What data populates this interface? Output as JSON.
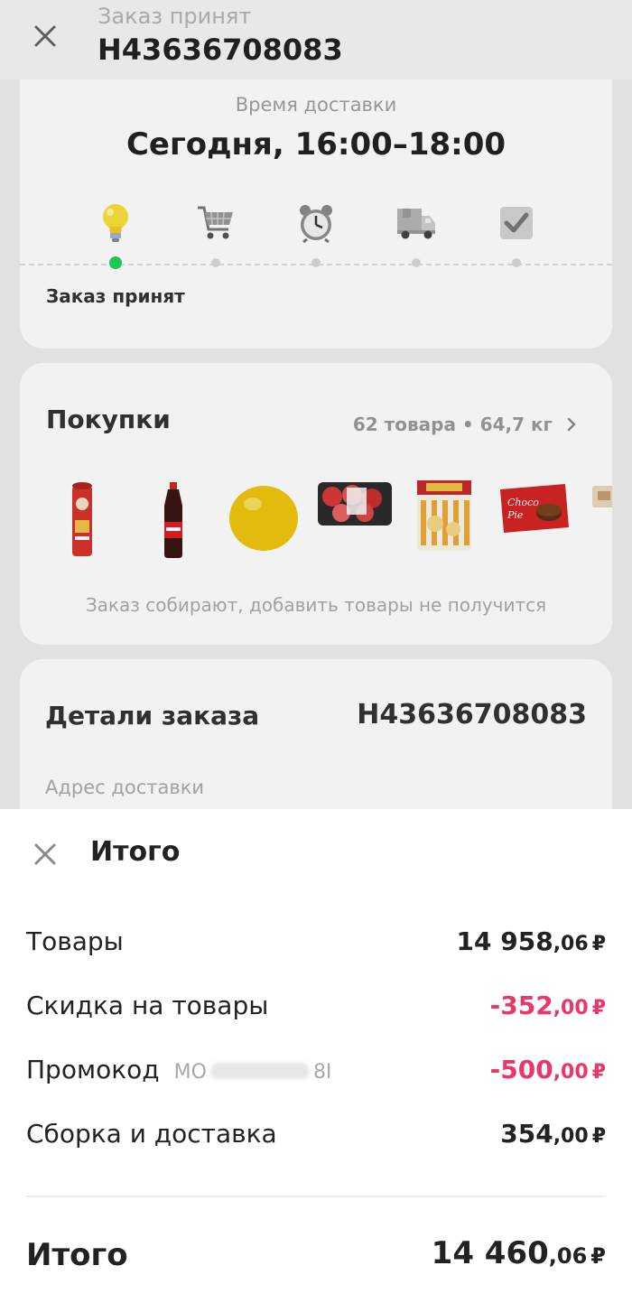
{
  "header": {
    "subtitle": "Заказ принят",
    "order_number": "H43636708083",
    "close_icon": "close-icon"
  },
  "delivery": {
    "label": "Время доставки",
    "time": "Сегодня, 16:00–18:00",
    "steps": [
      {
        "icon": "lightbulb-icon",
        "active": true
      },
      {
        "icon": "shopping-cart-icon",
        "active": false
      },
      {
        "icon": "alarm-clock-icon",
        "active": false
      },
      {
        "icon": "delivery-truck-icon",
        "active": false
      },
      {
        "icon": "checkbox-icon",
        "active": false
      }
    ],
    "status": "Заказ принят",
    "accent_color": "#1fd15c"
  },
  "purchases": {
    "title": "Покупки",
    "meta": "62 товара • 64,7 кг",
    "products": [
      "pringles-can",
      "cola-bottle",
      "yellow-pomelo",
      "apples-tray",
      "snack-bag",
      "choco-pie-box",
      "product-partial"
    ],
    "note": "Заказ собирают, добавить товары не получится"
  },
  "details": {
    "title": "Детали заказа",
    "number": "H43636708083",
    "address_label": "Адрес доставки"
  },
  "summary": {
    "title": "Итого",
    "rows": [
      {
        "label": "Товары",
        "int": "14 958",
        "frac": ",06",
        "currency": "₽"
      },
      {
        "label": "Скидка на товары",
        "int": "-352",
        "frac": ",00",
        "currency": "₽"
      },
      {
        "label": "Промокод",
        "code_start": "MO",
        "code_end": "8I",
        "int": "-500",
        "frac": ",00",
        "currency": "₽"
      },
      {
        "label": "Сборка и доставка",
        "int": "354",
        "frac": ",00",
        "currency": "₽"
      }
    ],
    "total_label": "Итого",
    "total_int": "14 460",
    "total_frac": ",06",
    "total_currency": "₽",
    "negative_color": "#e8386a"
  }
}
